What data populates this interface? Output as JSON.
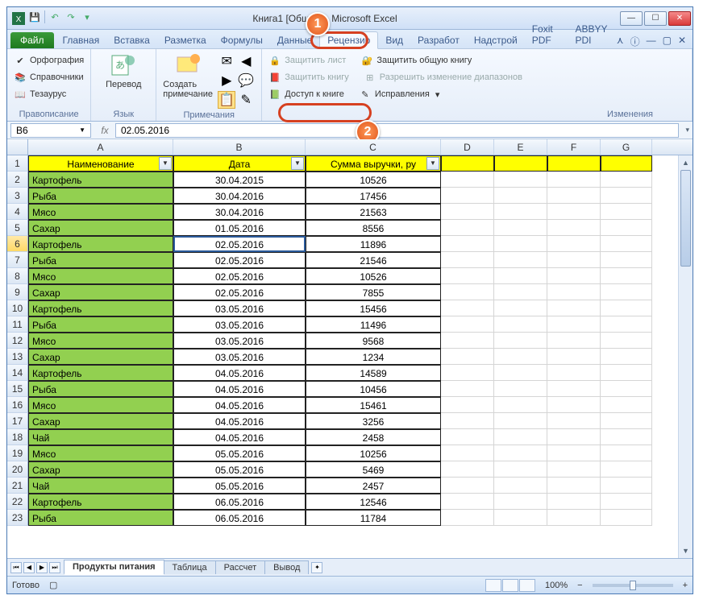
{
  "window": {
    "title": "Книга1 [Общий] - Microsoft Excel"
  },
  "qat": {
    "save": "save-icon",
    "undo": "undo-icon",
    "redo": "redo-icon"
  },
  "ribbon": {
    "file": "Файл",
    "tabs": [
      "Главная",
      "Вставка",
      "Разметка",
      "Формулы",
      "Данные",
      "Рецензир",
      "Вид",
      "Разработ",
      "Надстрой",
      "Foxit PDF",
      "ABBYY PDI"
    ],
    "active_tab": "Рецензир",
    "groups": {
      "proofing": {
        "label": "Правописание",
        "items": {
          "spelling": "Орфография",
          "research": "Справочники",
          "thesaurus": "Тезаурус"
        }
      },
      "language": {
        "label": "Язык",
        "translate": "Перевод"
      },
      "comments": {
        "label": "Примечания",
        "new_comment": "Создать примечание"
      },
      "changes": {
        "label": "Изменения",
        "protect_sheet": "Защитить лист",
        "protect_book": "Защитить книгу",
        "share_book": "Доступ к книге",
        "protect_shared": "Защитить общую книгу",
        "allow_ranges": "Разрешить изменение диапазонов",
        "track_changes": "Исправления"
      }
    }
  },
  "callouts": {
    "one": "1",
    "two": "2"
  },
  "formula_bar": {
    "name_box": "B6",
    "fx": "fx",
    "formula": "02.05.2016"
  },
  "grid": {
    "columns": [
      "A",
      "B",
      "C",
      "D",
      "E",
      "F",
      "G"
    ],
    "header_row": [
      "Наименование",
      "Дата",
      "Сумма выручки, ру"
    ],
    "selected_cell": "B6",
    "rows": [
      {
        "n": 2,
        "a": "Картофель",
        "b": "30.04.2015",
        "c": "10526"
      },
      {
        "n": 3,
        "a": "Рыба",
        "b": "30.04.2016",
        "c": "17456"
      },
      {
        "n": 4,
        "a": "Мясо",
        "b": "30.04.2016",
        "c": "21563"
      },
      {
        "n": 5,
        "a": "Сахар",
        "b": "01.05.2016",
        "c": "8556"
      },
      {
        "n": 6,
        "a": "Картофель",
        "b": "02.05.2016",
        "c": "11896"
      },
      {
        "n": 7,
        "a": "Рыба",
        "b": "02.05.2016",
        "c": "21546"
      },
      {
        "n": 8,
        "a": "Мясо",
        "b": "02.05.2016",
        "c": "10526"
      },
      {
        "n": 9,
        "a": "Сахар",
        "b": "02.05.2016",
        "c": "7855"
      },
      {
        "n": 10,
        "a": "Картофель",
        "b": "03.05.2016",
        "c": "15456"
      },
      {
        "n": 11,
        "a": "Рыба",
        "b": "03.05.2016",
        "c": "11496"
      },
      {
        "n": 12,
        "a": "Мясо",
        "b": "03.05.2016",
        "c": "9568"
      },
      {
        "n": 13,
        "a": "Сахар",
        "b": "03.05.2016",
        "c": "1234"
      },
      {
        "n": 14,
        "a": "Картофель",
        "b": "04.05.2016",
        "c": "14589"
      },
      {
        "n": 15,
        "a": "Рыба",
        "b": "04.05.2016",
        "c": "10456"
      },
      {
        "n": 16,
        "a": "Мясо",
        "b": "04.05.2016",
        "c": "15461"
      },
      {
        "n": 17,
        "a": "Сахар",
        "b": "04.05.2016",
        "c": "3256"
      },
      {
        "n": 18,
        "a": "Чай",
        "b": "04.05.2016",
        "c": "2458"
      },
      {
        "n": 19,
        "a": "Мясо",
        "b": "05.05.2016",
        "c": "10256"
      },
      {
        "n": 20,
        "a": "Сахар",
        "b": "05.05.2016",
        "c": "5469"
      },
      {
        "n": 21,
        "a": "Чай",
        "b": "05.05.2016",
        "c": "2457"
      },
      {
        "n": 22,
        "a": "Картофель",
        "b": "06.05.2016",
        "c": "12546"
      },
      {
        "n": 23,
        "a": "Рыба",
        "b": "06.05.2016",
        "c": "11784"
      }
    ]
  },
  "sheets": {
    "tabs": [
      "Продукты питания",
      "Таблица",
      "Рассчет",
      "Вывод"
    ],
    "active": "Продукты питания"
  },
  "status": {
    "ready": "Готово",
    "zoom": "100%"
  }
}
